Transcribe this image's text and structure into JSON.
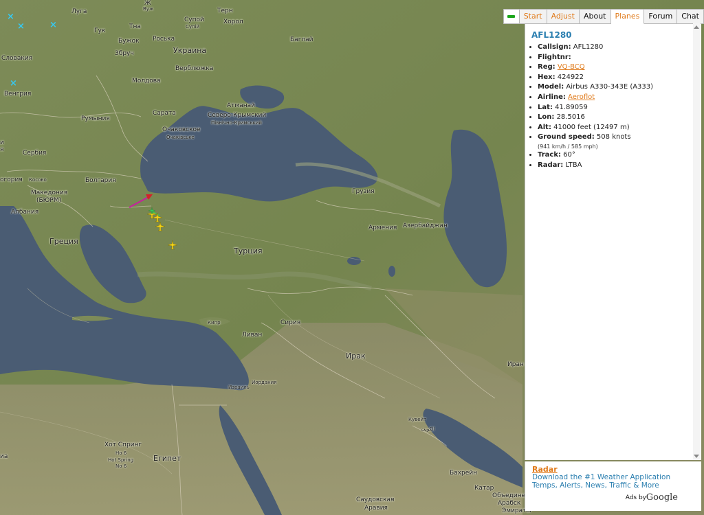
{
  "tabs": {
    "start": "Start",
    "adjust": "Adjust",
    "about": "About",
    "planes": "Planes",
    "forum": "Forum",
    "chat": "Chat"
  },
  "flight": {
    "title": "AFL1280",
    "callsign_label": "Callsign:",
    "callsign": "AFL1280",
    "flightnr_label": "Flightnr:",
    "flightnr": "",
    "reg_label": "Reg:",
    "reg": "VQ-BCQ",
    "hex_label": "Hex:",
    "hex": "424922",
    "model_label": "Model:",
    "model": "Airbus A330-343E (A333)",
    "airline_label": "Airline:",
    "airline": "Aeroflot",
    "lat_label": "Lat:",
    "lat": "41.89059",
    "lon_label": "Lon:",
    "lon": "28.5016",
    "alt_label": "Alt:",
    "alt": "41000 feet (12497 m)",
    "gs_label": "Ground speed:",
    "gs": "508 knots",
    "gs_sub": "(941 km/h / 585 mph)",
    "track_label": "Track:",
    "track": "60°",
    "radar_label": "Radar:",
    "radar": "LTBA"
  },
  "ad": {
    "title": "Radar",
    "line1": "Download the #1 Weather Application",
    "line2": "Temps, Alerts, News, Traffic & More",
    "ads_by": "Ads by",
    "google": "Google"
  },
  "map_labels": {
    "luga": "Луга",
    "zh": "Ж",
    "vuzh": "Вуж",
    "tern": "Терн",
    "tna": "Тна",
    "supoy": "Супой",
    "supoi2": "Супій",
    "khorol": "Хорол",
    "guk": "Гук",
    "buzhok": "Бужок",
    "roska": "Роська",
    "baglai": "Баглай",
    "zbruch": "Збруч",
    "ukraina": "Украина",
    "slovakia": "Словакия",
    "verblyuzhka": "Верблюжка",
    "moldova": "Молдова",
    "vengria": "Венгрия",
    "rumynia": "Румыния",
    "sarata": "Сарата",
    "atmanai": "Атманай",
    "severo": "Северо-Крымский",
    "pivnichno": "Північно-Кримський",
    "ochakovskoe": "Очаковское",
    "ochakivske": "Очаківське",
    "i": "и",
    "ya": "я",
    "serbia": "Сербия",
    "bolgaria": "Болгария",
    "ogoria": "огория",
    "kosovo": "Косово",
    "makedonia": "Македония",
    "byurm": "(БЮРМ)",
    "albania": "Албания",
    "gruzia": "Грузия",
    "armenia": "Армения",
    "azerbaijan": "Азербайджан",
    "gretsia": "Греция",
    "turtsia": "Турция",
    "kipr": "Кипр",
    "siria": "Сирия",
    "livan": "Ливан",
    "irak": "Ирак",
    "iran": "Иран",
    "izrail": "Израиль",
    "iordania": "Иордания",
    "kuveit": "Кувейт",
    "alkuwait": "الكويت",
    "khot_spring": "Хот Спринг",
    "ho6": "Но 6",
    "hot_spring": "Hot Spring",
    "no6": "No 6",
    "egipet": "Египет",
    "ia": "иа",
    "bakhrein": "Бахрейн",
    "katar": "Катар",
    "obedinen": "Объедине",
    "arabsk": "Арабск",
    "emiraty": "Эмираты",
    "saudovskaya": "Саудовская",
    "aravia": "Аравия"
  },
  "colors": {
    "accent_blue": "#2b7fb0",
    "accent_orange": "#e07a1a",
    "plane_yellow": "#f2d21a",
    "plane_green": "#3cc85a",
    "track_magenta": "#c81ea0",
    "track_red": "#d4202a",
    "marker_cyan": "#37c8f0"
  }
}
